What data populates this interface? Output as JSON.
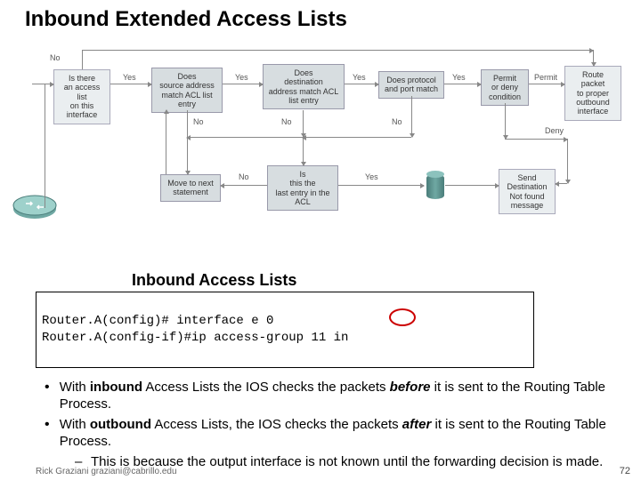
{
  "title": "Inbound Extended Access Lists",
  "subtitle": "Inbound Access Lists",
  "flow": {
    "q_access_list": "Is there\nan access list\non this\ninterface",
    "q_src": "Does\nsource address\nmatch ACL list\nentry",
    "q_dst": "Does\ndestination\naddress match ACL\nlist entry",
    "q_proto": "Does protocol\nand port match",
    "q_permit": "Permit\nor deny\ncondition",
    "route_packet": "Route packet\nto proper\noutbound\ninterface",
    "move_next": "Move to next\nstatement",
    "q_last": "Is\nthis the\nlast entry in the\nACL",
    "send_dest": "Send\nDestination\nNot found\nmessage",
    "yes": "Yes",
    "no": "No",
    "permit": "Permit",
    "deny": "Deny"
  },
  "code": {
    "line1": "Router.A(config)# interface e 0",
    "line2": "Router.A(config-if)#ip access-group 11 in"
  },
  "bullets": {
    "b1a": "With ",
    "b1b": "inbound",
    "b1c": " Access Lists the IOS checks the packets ",
    "b1d": "before",
    "b1e": " it is sent to the Routing Table Process.",
    "b2a": "With ",
    "b2b": "outbound",
    "b2c": " Access Lists, the IOS checks the packets ",
    "b2d": "after",
    "b2e": " it is sent to the Routing Table Process.",
    "sub1": "This is because the output interface is not known until the forwarding decision is made."
  },
  "footer": "Rick Graziani graziani@cabrillo.edu",
  "page": "72"
}
